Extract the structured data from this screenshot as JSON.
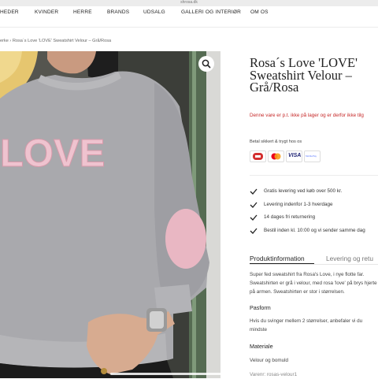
{
  "browser": {
    "url": "shrosa.dk"
  },
  "nav": {
    "items": [
      "HEDER",
      "KVINDER",
      "HERRE",
      "BRANDS",
      "UDSALG",
      "GALLERI OG INTERIØR",
      "OM OS"
    ]
  },
  "breadcrumb": "erke › Rosa´s Love 'LOVE' Sweatshirt Velour – Grå/Rosa",
  "product": {
    "image_text": "LOVE",
    "title": "Rosa´s Love 'LOVE' Sweatshirt Velour – Grå/Rosa",
    "stock_notice": "Denne vare er p.t. ikke på lager og er derfor ikke tilg",
    "pay_label": "Betal sikkert & trygt hos os",
    "payment_icons": [
      "dankort-icon",
      "mastercard-icon",
      "visa-icon",
      "mobilepay-icon"
    ],
    "visa_text": "VISA",
    "mobilepay_text": "MobilePay"
  },
  "benefits": [
    "Gratis levering ved køb over 500 kr.",
    "Levering indenfor 1-3 hverdage",
    "14 dages fri returnering",
    "Bestil inden kl. 10:00 og vi sender samme dag"
  ],
  "tabs": [
    "Produktinformation",
    "Levering og retu"
  ],
  "info": {
    "description": "Super fed sweatshirt fra Rosa's Love, i nye flotte far. Sweatshirten er grå i velour, med rosa 'love' på brys hjerte på armen. Sweatshirten er stor i størrelsen.",
    "fit_heading": "Pasform",
    "fit_text": "Hvis du svinger mellem 2 størrelser, anbefaler vi du mindste",
    "material_heading": "Materiale",
    "material_text": "Velour og bomuld",
    "sku": "Varenr: rosas-velour1"
  },
  "colors": {
    "accent_red": "#c62828",
    "text": "#222222",
    "sweater": "#a7a7ab",
    "pink": "#eab7c4"
  }
}
